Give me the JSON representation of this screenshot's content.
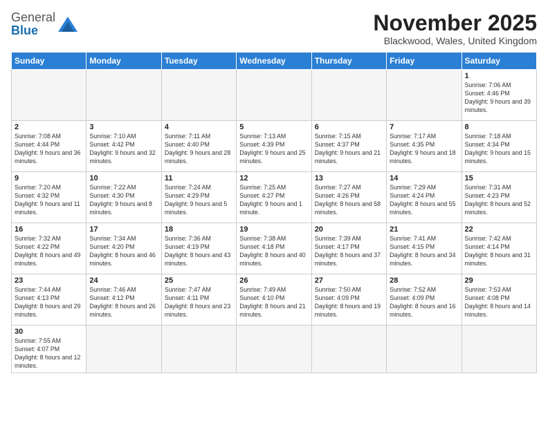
{
  "logo": {
    "text_general": "General",
    "text_blue": "Blue"
  },
  "header": {
    "month_title": "November 2025",
    "location": "Blackwood, Wales, United Kingdom"
  },
  "weekdays": [
    "Sunday",
    "Monday",
    "Tuesday",
    "Wednesday",
    "Thursday",
    "Friday",
    "Saturday"
  ],
  "weeks": [
    [
      {
        "day": "",
        "empty": true
      },
      {
        "day": "",
        "empty": true
      },
      {
        "day": "",
        "empty": true
      },
      {
        "day": "",
        "empty": true
      },
      {
        "day": "",
        "empty": true
      },
      {
        "day": "",
        "empty": true
      },
      {
        "day": "1",
        "sunrise": "7:06 AM",
        "sunset": "4:46 PM",
        "daylight": "9 hours and 39 minutes."
      }
    ],
    [
      {
        "day": "2",
        "sunrise": "7:08 AM",
        "sunset": "4:44 PM",
        "daylight": "9 hours and 36 minutes."
      },
      {
        "day": "3",
        "sunrise": "7:10 AM",
        "sunset": "4:42 PM",
        "daylight": "9 hours and 32 minutes."
      },
      {
        "day": "4",
        "sunrise": "7:11 AM",
        "sunset": "4:40 PM",
        "daylight": "9 hours and 28 minutes."
      },
      {
        "day": "5",
        "sunrise": "7:13 AM",
        "sunset": "4:39 PM",
        "daylight": "9 hours and 25 minutes."
      },
      {
        "day": "6",
        "sunrise": "7:15 AM",
        "sunset": "4:37 PM",
        "daylight": "9 hours and 21 minutes."
      },
      {
        "day": "7",
        "sunrise": "7:17 AM",
        "sunset": "4:35 PM",
        "daylight": "9 hours and 18 minutes."
      },
      {
        "day": "8",
        "sunrise": "7:18 AM",
        "sunset": "4:34 PM",
        "daylight": "9 hours and 15 minutes."
      }
    ],
    [
      {
        "day": "9",
        "sunrise": "7:20 AM",
        "sunset": "4:32 PM",
        "daylight": "9 hours and 11 minutes."
      },
      {
        "day": "10",
        "sunrise": "7:22 AM",
        "sunset": "4:30 PM",
        "daylight": "9 hours and 8 minutes."
      },
      {
        "day": "11",
        "sunrise": "7:24 AM",
        "sunset": "4:29 PM",
        "daylight": "9 hours and 5 minutes."
      },
      {
        "day": "12",
        "sunrise": "7:25 AM",
        "sunset": "4:27 PM",
        "daylight": "9 hours and 1 minute."
      },
      {
        "day": "13",
        "sunrise": "7:27 AM",
        "sunset": "4:26 PM",
        "daylight": "8 hours and 58 minutes."
      },
      {
        "day": "14",
        "sunrise": "7:29 AM",
        "sunset": "4:24 PM",
        "daylight": "8 hours and 55 minutes."
      },
      {
        "day": "15",
        "sunrise": "7:31 AM",
        "sunset": "4:23 PM",
        "daylight": "8 hours and 52 minutes."
      }
    ],
    [
      {
        "day": "16",
        "sunrise": "7:32 AM",
        "sunset": "4:22 PM",
        "daylight": "8 hours and 49 minutes."
      },
      {
        "day": "17",
        "sunrise": "7:34 AM",
        "sunset": "4:20 PM",
        "daylight": "8 hours and 46 minutes."
      },
      {
        "day": "18",
        "sunrise": "7:36 AM",
        "sunset": "4:19 PM",
        "daylight": "8 hours and 43 minutes."
      },
      {
        "day": "19",
        "sunrise": "7:38 AM",
        "sunset": "4:18 PM",
        "daylight": "8 hours and 40 minutes."
      },
      {
        "day": "20",
        "sunrise": "7:39 AM",
        "sunset": "4:17 PM",
        "daylight": "8 hours and 37 minutes."
      },
      {
        "day": "21",
        "sunrise": "7:41 AM",
        "sunset": "4:15 PM",
        "daylight": "8 hours and 34 minutes."
      },
      {
        "day": "22",
        "sunrise": "7:42 AM",
        "sunset": "4:14 PM",
        "daylight": "8 hours and 31 minutes."
      }
    ],
    [
      {
        "day": "23",
        "sunrise": "7:44 AM",
        "sunset": "4:13 PM",
        "daylight": "8 hours and 29 minutes."
      },
      {
        "day": "24",
        "sunrise": "7:46 AM",
        "sunset": "4:12 PM",
        "daylight": "8 hours and 26 minutes."
      },
      {
        "day": "25",
        "sunrise": "7:47 AM",
        "sunset": "4:11 PM",
        "daylight": "8 hours and 23 minutes."
      },
      {
        "day": "26",
        "sunrise": "7:49 AM",
        "sunset": "4:10 PM",
        "daylight": "8 hours and 21 minutes."
      },
      {
        "day": "27",
        "sunrise": "7:50 AM",
        "sunset": "4:09 PM",
        "daylight": "8 hours and 19 minutes."
      },
      {
        "day": "28",
        "sunrise": "7:52 AM",
        "sunset": "4:09 PM",
        "daylight": "8 hours and 16 minutes."
      },
      {
        "day": "29",
        "sunrise": "7:53 AM",
        "sunset": "4:08 PM",
        "daylight": "8 hours and 14 minutes."
      }
    ],
    [
      {
        "day": "30",
        "sunrise": "7:55 AM",
        "sunset": "4:07 PM",
        "daylight": "8 hours and 12 minutes."
      },
      {
        "day": "",
        "empty": true
      },
      {
        "day": "",
        "empty": true
      },
      {
        "day": "",
        "empty": true
      },
      {
        "day": "",
        "empty": true
      },
      {
        "day": "",
        "empty": true
      },
      {
        "day": "",
        "empty": true
      }
    ]
  ]
}
